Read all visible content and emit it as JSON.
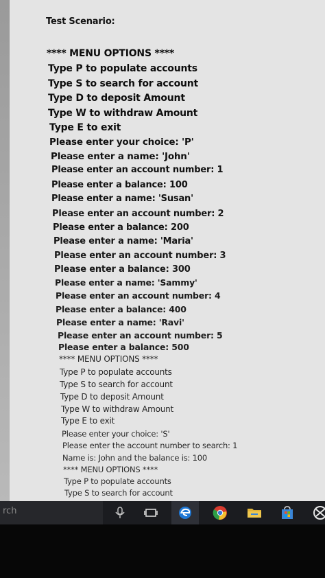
{
  "console": {
    "lines": [
      "Test Scenario:",
      "",
      "**** MENU OPTIONS ****",
      "Type P to populate accounts",
      "Type S to search for account",
      "Type D to deposit Amount",
      "Type W to withdraw Amount",
      "Type E to exit",
      "Please enter your choice: 'P'",
      "Please enter a name: 'John'",
      "Please enter an account number: 1",
      "Please enter a balance: 100",
      "Please enter a name: 'Susan'",
      "Please enter an account number: 2",
      "Please enter a balance: 200",
      "Please enter a name: 'Maria'",
      "Please enter an account number: 3",
      "Please enter a balance: 300",
      "Please enter a name: 'Sammy'",
      "Please enter an account number: 4",
      "Please enter a balance: 400",
      "Please enter a name: 'Ravi'",
      "Please enter an account number: 5",
      "Please enter a balance: 500",
      "**** MENU OPTIONS ****",
      "Type P to populate accounts",
      "Type S to search for account",
      "Type D to deposit Amount",
      "Type W to withdraw Amount",
      "Type E to exit",
      "Please enter your choice: 'S'",
      "Please enter the account number to search: 1",
      "Name is: John and the balance is: 100",
      "**** MENU OPTIONS ****",
      "Type P to populate accounts",
      "Type S to search for account"
    ]
  },
  "taskbar": {
    "search_text": "rch",
    "icons": [
      "microphone-icon",
      "task-view-icon",
      "edge-icon",
      "chrome-icon",
      "file-explorer-icon",
      "store-icon",
      "xbox-icon"
    ],
    "colors": {
      "edge": "#1e78d6",
      "explorer": "#e2b43a",
      "store": "#3a86d8",
      "chrome_red": "#d83b2f",
      "chrome_yellow": "#f2c12e",
      "chrome_green": "#2f9e46"
    }
  }
}
